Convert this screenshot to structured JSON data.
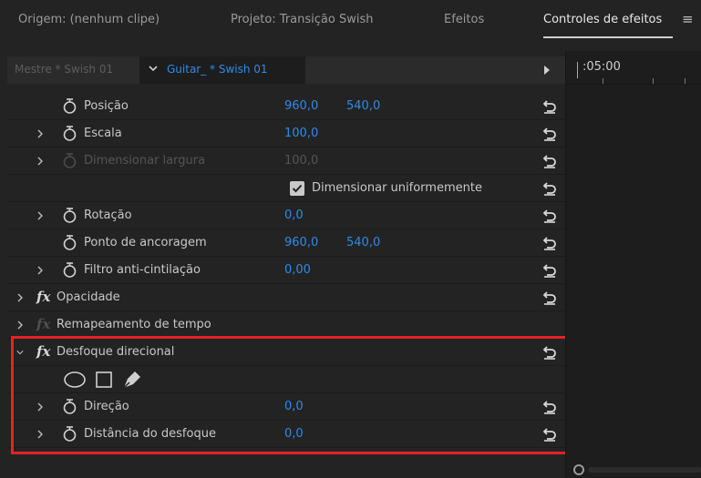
{
  "tabs": [
    {
      "label": "Origem: (nenhum clipe)"
    },
    {
      "label": "Projeto: Transição Swish"
    },
    {
      "label": "Efeitos"
    },
    {
      "label": "Controles de efeitos"
    }
  ],
  "menu_icon": "hamburger-menu-icon",
  "clip": {
    "master_label": "Mestre * Swish 01",
    "selected_label": "Guitar_ * Swish 01"
  },
  "timeline": {
    "timecode": ":05:00"
  },
  "rows": {
    "posicao": {
      "label": "Posição",
      "x": "960,0",
      "y": "540,0"
    },
    "escala": {
      "label": "Escala",
      "value": "100,0"
    },
    "dim_largura": {
      "label": "Dimensionar largura",
      "value": "100,0"
    },
    "uniform": {
      "label": "Dimensionar uniformemente",
      "checked": true
    },
    "rotacao": {
      "label": "Rotação",
      "value": "0,0"
    },
    "ancoragem": {
      "label": "Ponto de ancoragem",
      "x": "960,0",
      "y": "540,0"
    },
    "filtro": {
      "label": "Filtro anti-cintilação",
      "value": "0,00"
    },
    "opacidade": {
      "label": "Opacidade"
    },
    "remap": {
      "label": "Remapeamento de tempo"
    },
    "desfoque": {
      "label": "Desfoque direcional"
    },
    "direcao": {
      "label": "Direção",
      "value": "0,0"
    },
    "distancia": {
      "label": "Distância do desfoque",
      "value": "0,0"
    }
  },
  "fx_label": "fx",
  "colors": {
    "accent_blue": "#2d8ceb",
    "highlight_red": "#e8202a",
    "panel_bg": "#232323"
  }
}
